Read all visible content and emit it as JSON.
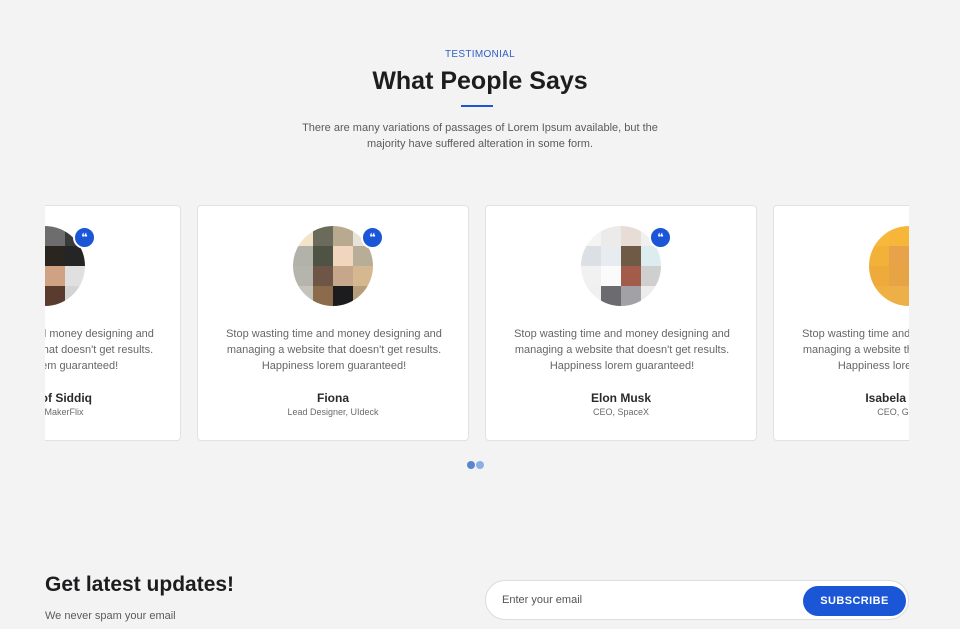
{
  "section": {
    "eyebrow": "TESTIMONIAL",
    "title": "What People Says",
    "subtitle": "There are many variations of passages of Lorem Ipsum available, but the majority have suffered alteration in some form."
  },
  "testimonials": [
    {
      "quote": "Stop wasting time and money designing and managing a website that doesn't get results. Happiness lorem guaranteed!",
      "name": "Musharof Siddiq",
      "role": "Founder, MakerFlix",
      "avatar": [
        "#e9e9e9",
        "#d9d9d9",
        "#6d6d6d",
        "#3a3a3a",
        "#f0f0f0",
        "#e8c8ac",
        "#2b2520",
        "#252525",
        "#dcdcdc",
        "#d6a98a",
        "#cfa284",
        "#e0e0e0",
        "#c9c9c9",
        "#6d4a3a",
        "#5a3c2f",
        "#d4d4d4"
      ]
    },
    {
      "quote": "Stop wasting time and money designing and managing a website that doesn't get results. Happiness lorem guaranteed!",
      "name": "Fiona",
      "role": "Lead Designer, UIdeck",
      "avatar": [
        "#f2e3c9",
        "#6a6b5a",
        "#b9a98f",
        "#e8e3d8",
        "#b3b2aa",
        "#4f5344",
        "#f1d6bd",
        "#b8ae98",
        "#b6b5ad",
        "#6e5646",
        "#c7a78c",
        "#d6b890",
        "#c5c4bc",
        "#8c6a4c",
        "#1c1c1f",
        "#b89d7a"
      ]
    },
    {
      "quote": "Stop wasting time and money designing and managing a website that doesn't get results. Happiness lorem guaranteed!",
      "name": "Elon Musk",
      "role": "CEO, SpaceX",
      "avatar": [
        "#f4f4f4",
        "#ecebea",
        "#e8dcd6",
        "#f0f0f0",
        "#dcdfe3",
        "#e6ecf0",
        "#6f5a45",
        "#dcecef",
        "#f1f1f1",
        "#fbfbfb",
        "#a45c4a",
        "#cfcfcf",
        "#f0f0f0",
        "#6b6b70",
        "#a1a1a6",
        "#ececec"
      ]
    },
    {
      "quote": "Stop wasting time and money designing and managing a website that doesn't get results. Happiness lorem guaranteed!",
      "name": "Isabela Moreira",
      "role": "CEO, Graygrids",
      "avatar": [
        "#f6b93c",
        "#f7b53a",
        "#f3c25a",
        "#f5b94a",
        "#f2b23a",
        "#e8a24a",
        "#d99a7a",
        "#e3a878",
        "#eeaa3a",
        "#e7a445",
        "#dba082",
        "#e09e70",
        "#f0b040",
        "#edb048",
        "#e8ad5a",
        "#ecb050"
      ]
    }
  ],
  "carousel": {
    "dot_colors": [
      "#5b86cf",
      "#8aaee6"
    ]
  },
  "newsletter": {
    "title": "Get latest updates!",
    "subtitle": "We never spam your email",
    "placeholder": "Enter your email",
    "button_label": "SUBSCRIBE"
  }
}
